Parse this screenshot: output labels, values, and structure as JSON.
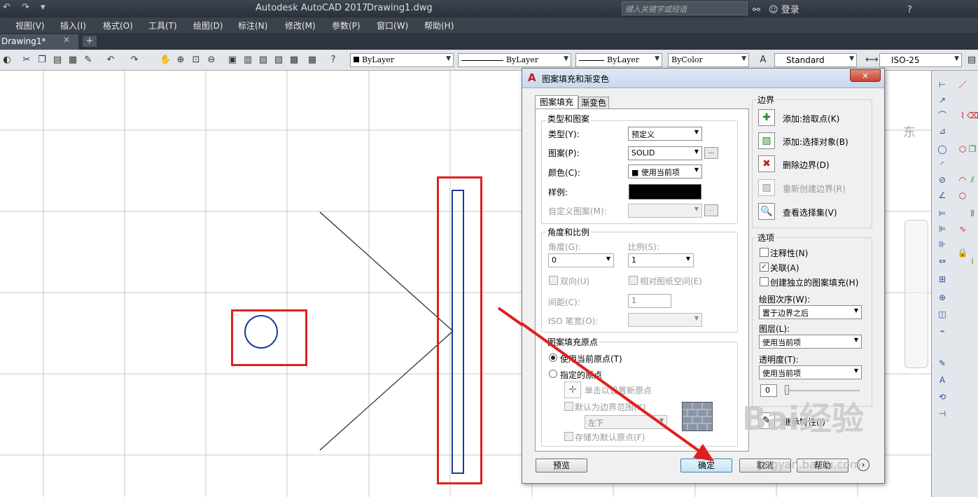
{
  "app": {
    "title": "Autodesk AutoCAD 2017",
    "file": "Drawing1.dwg",
    "search_placeholder": "键入关键字或短语",
    "login": "登录"
  },
  "menu": [
    "视图(V)",
    "插入(I)",
    "格式(O)",
    "工具(T)",
    "绘图(D)",
    "标注(N)",
    "修改(M)",
    "参数(P)",
    "窗口(W)",
    "帮助(H)"
  ],
  "doc_tab": {
    "label": "Drawing1*"
  },
  "toolbar": {
    "layer": "ByLayer",
    "linetype": "ByLayer",
    "lineweight": "ByLayer",
    "color": "ByColor",
    "text_style": "Standard",
    "dim_style": "ISO-25"
  },
  "canvas": {
    "compass_label": "东"
  },
  "dialog": {
    "title": "图案填充和渐变色",
    "close": "×",
    "tabs": [
      "图案填充",
      "渐变色"
    ],
    "type_pattern": {
      "group": "类型和图案",
      "type_label": "类型(Y):",
      "type_value": "预定义",
      "pattern_label": "图案(P):",
      "pattern_value": "SOLID",
      "color_label": "颜色(C):",
      "color_value": "■ 使用当前项",
      "swatch_label": "样例:",
      "custom_label": "自定义图案(M):"
    },
    "angle_scale": {
      "group": "角度和比例",
      "angle_label": "角度(G):",
      "angle_value": "0",
      "scale_label": "比例(S):",
      "scale_value": "1",
      "double_label": "双向(U)",
      "relative_label": "相对图纸空间(E)",
      "spacing_label": "间距(C):",
      "spacing_value": "1",
      "iso_label": "ISO 笔宽(O):"
    },
    "origin": {
      "group": "图案填充原点",
      "use_current": "使用当前原点(T)",
      "specified": "指定的原点",
      "click_set": "单击以设置新原点",
      "default_extents": "默认为边界范围(X)",
      "position_value": "左下",
      "store_default": "存储为默认原点(F)"
    },
    "boundary": {
      "group": "边界",
      "add_pick": "添加:拾取点(K)",
      "add_select": "添加:选择对象(B)",
      "remove": "删除边界(D)",
      "recreate": "重新创建边界(R)",
      "view_sel": "查看选择集(V)"
    },
    "options": {
      "group": "选项",
      "annotative": "注释性(N)",
      "associative": "关联(A)",
      "separate": "创建独立的图案填充(H)",
      "draw_order_label": "绘图次序(W):",
      "draw_order_value": "置于边界之后",
      "layer_label": "图层(L):",
      "layer_value": "使用当前项",
      "transparency_label": "透明度(T):",
      "transparency_value": "使用当前项",
      "transparency_num": "0"
    },
    "inherit": "继承特性(I)",
    "buttons": {
      "preview": "预览",
      "ok": "确定",
      "cancel": "取消",
      "help": "帮助"
    }
  },
  "watermark": {
    "text": "Bai经验",
    "url": "jingyan.baidu.com"
  }
}
